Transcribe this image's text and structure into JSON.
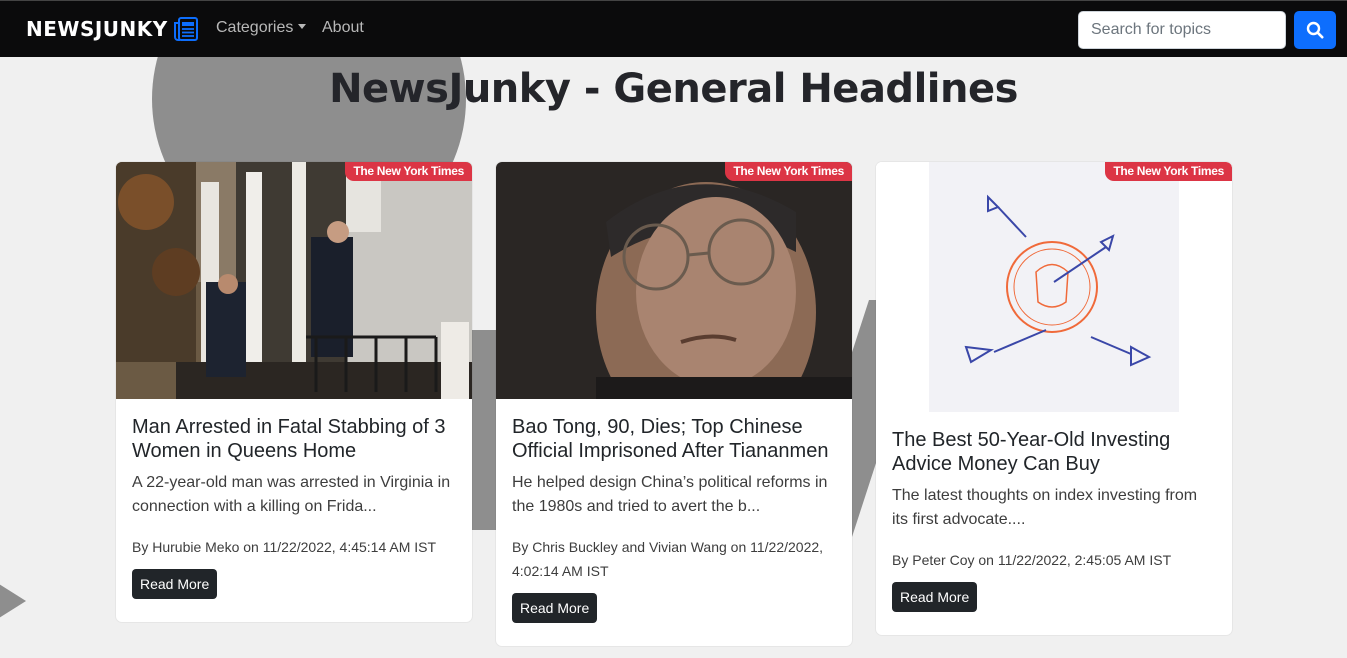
{
  "navbar": {
    "brand": "NEWSJUNKY",
    "brand_icon": "newspaper-icon",
    "categories_label": "Categories",
    "about_label": "About",
    "search_placeholder": "Search for topics",
    "search_icon": "search-icon",
    "accent_color": "#0d6efd"
  },
  "page": {
    "title": "NewsJunky - General Headlines"
  },
  "articles": [
    {
      "source": "The New York Times",
      "title": "Man Arrested in Fatal Stabbing of 3 Women in Queens Home",
      "description": "A 22-year-old man was arrested in Virginia in connection with a killing on Frida...",
      "meta": "By Hurubie Meko on 11/22/2022, 4:45:14 AM IST",
      "button": "Read More",
      "image": "police officers outside house"
    },
    {
      "source": "The New York Times",
      "title": "Bao Tong, 90, Dies; Top Chinese Official Imprisoned After Tiananmen",
      "description": "He helped design China’s political reforms in the 1980s and tried to avert the b...",
      "meta": "By Chris Buckley and Vivian Wang on 11/22/2022, 4:02:14 AM IST",
      "button": "Read More",
      "image": "portrait of elderly man with glasses"
    },
    {
      "source": "The New York Times",
      "title": "The Best 50-Year-Old Investing Advice Money Can Buy",
      "description": "The latest thoughts on index investing from its first advocate....",
      "meta": "By Peter Coy on 11/22/2022, 2:45:05 AM IST",
      "button": "Read More",
      "image": "darts around a seal illustration"
    }
  ],
  "colors": {
    "badge": "#dc3545",
    "navbar_bg": "#0b0b0c",
    "button_dark": "#212529"
  }
}
